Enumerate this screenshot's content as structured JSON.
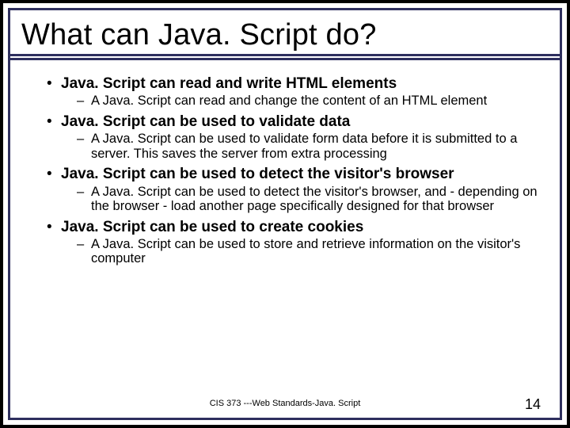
{
  "title": "What can Java. Script do?",
  "bullets": [
    {
      "text": "Java. Script can read and write HTML elements",
      "sub": "A Java. Script can read and change the content of an HTML element"
    },
    {
      "text": "Java. Script can be used to validate data",
      "sub": "A Java. Script can be used to validate form data before it is submitted to a server. This saves the server from extra processing"
    },
    {
      "text": "Java. Script can be used to detect the visitor's browser",
      "sub": "A Java. Script can be used to detect the visitor's browser, and - depending on the browser - load another page specifically designed for that browser"
    },
    {
      "text": "Java. Script can be used to create cookies",
      "sub": "A Java. Script can be used to store and retrieve information on the visitor's computer"
    }
  ],
  "footer": "CIS 373 ---Web Standards-Java. Script",
  "page_number": "14"
}
